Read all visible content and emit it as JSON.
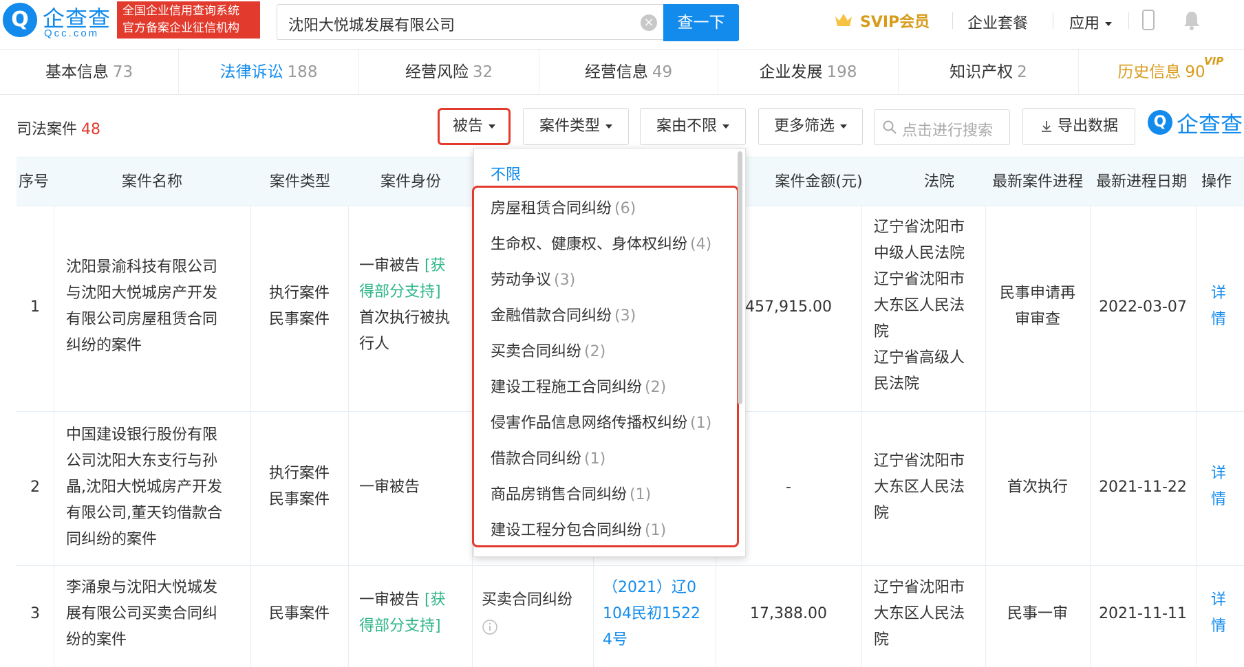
{
  "header": {
    "logo_text": "企查查",
    "logo_url": "Qcc.com",
    "badge_line1": "全国企业信用查询系统",
    "badge_line2": "官方备案企业征信机构",
    "search_value": "沈阳大悦城发展有限公司",
    "search_button": "查一下",
    "svip": "SVIP会员",
    "nav": [
      "企业套餐",
      "应用"
    ]
  },
  "tabs": [
    {
      "label": "基本信息",
      "count": "73"
    },
    {
      "label": "法律诉讼",
      "count": "188"
    },
    {
      "label": "经营风险",
      "count": "32"
    },
    {
      "label": "经营信息",
      "count": "49"
    },
    {
      "label": "企业发展",
      "count": "198"
    },
    {
      "label": "知识产权",
      "count": "2"
    },
    {
      "label": "历史信息",
      "count": "90"
    }
  ],
  "vip_badge": "VIP",
  "section": {
    "title": "司法案件",
    "count": "48"
  },
  "filters": {
    "role": "被告",
    "case_type": "案件类型",
    "cause": "案由不限",
    "more": "更多筛选",
    "search_placeholder": "点击进行搜索",
    "export": "导出数据",
    "watermark": "企查查"
  },
  "table": {
    "headers": [
      "序号",
      "案件名称",
      "案件类型",
      "案件身份",
      "案件金额(元)",
      "法院",
      "最新案件进程",
      "最新进程日期",
      "操作"
    ],
    "rows": [
      {
        "no": "1",
        "name": [
          "沈阳景渝科技有限公司",
          "与沈阳大悦城房产开发",
          "有限公司房屋租赁合同",
          "纠纷的案件"
        ],
        "type": [
          "执行案件",
          "民事案件"
        ],
        "role_a": "一审被告",
        "role_b": "[获",
        "role_c": "得部分支持]",
        "role_d": [
          "首次执行被执",
          "行人"
        ],
        "amount": "457,915.00",
        "court": [
          "辽宁省沈阳市",
          "中级人民法院",
          "辽宁省沈阳市",
          "大东区人民法",
          "院",
          "辽宁省高级人",
          "民法院"
        ],
        "progress": [
          "民事申请再",
          "审审查"
        ],
        "date": "2022-03-07",
        "op": [
          "详",
          "情"
        ]
      },
      {
        "no": "2",
        "name": [
          "中国建设银行股份有限",
          "公司沈阳大东支行与孙",
          "晶,沈阳大悦城房产开发",
          "有限公司,董天钧借款合",
          "同纠纷的案件"
        ],
        "type": [
          "执行案件",
          "民事案件"
        ],
        "role_a": "一审被告",
        "amount": "-",
        "court": [
          "辽宁省沈阳市",
          "大东区人民法",
          "院"
        ],
        "progress": [
          "首次执行"
        ],
        "date": "2021-11-22",
        "op": [
          "详",
          "情"
        ]
      },
      {
        "no": "3",
        "name": [
          "李涌泉与沈阳大悦城发",
          "展有限公司买卖合同纠",
          "纷的案件"
        ],
        "type": [
          "民事案件"
        ],
        "role_a": "一审被告",
        "role_b": "[获",
        "role_c": "得部分支持]",
        "cause": "买卖合同纠纷",
        "case_no": [
          "（2021）辽0",
          "104民初1522",
          "4号"
        ],
        "amount": "17,388.00",
        "court": [
          "辽宁省沈阳市",
          "大东区人民法",
          "院"
        ],
        "progress": [
          "民事一审"
        ],
        "date": "2021-11-11",
        "op": [
          "详",
          "情"
        ]
      }
    ]
  },
  "dropdown": {
    "first": "不限",
    "items": [
      {
        "label": "房屋租赁合同纠纷",
        "count": "(6)"
      },
      {
        "label": "生命权、健康权、身体权纠纷",
        "count": "(4)"
      },
      {
        "label": "劳动争议",
        "count": "(3)"
      },
      {
        "label": "金融借款合同纠纷",
        "count": "(3)"
      },
      {
        "label": "买卖合同纠纷",
        "count": "(2)"
      },
      {
        "label": "建设工程施工合同纠纷",
        "count": "(2)"
      },
      {
        "label": "侵害作品信息网络传播权纠纷",
        "count": "(1)"
      },
      {
        "label": "借款合同纠纷",
        "count": "(1)"
      },
      {
        "label": "商品房销售合同纠纷",
        "count": "(1)"
      },
      {
        "label": "建设工程分包合同纠纷",
        "count": "(1)"
      }
    ]
  },
  "colors": {
    "brand": "#128bed",
    "highlight": "#e23a2c",
    "gold": "#d89c1c",
    "green": "#2eb58a"
  }
}
